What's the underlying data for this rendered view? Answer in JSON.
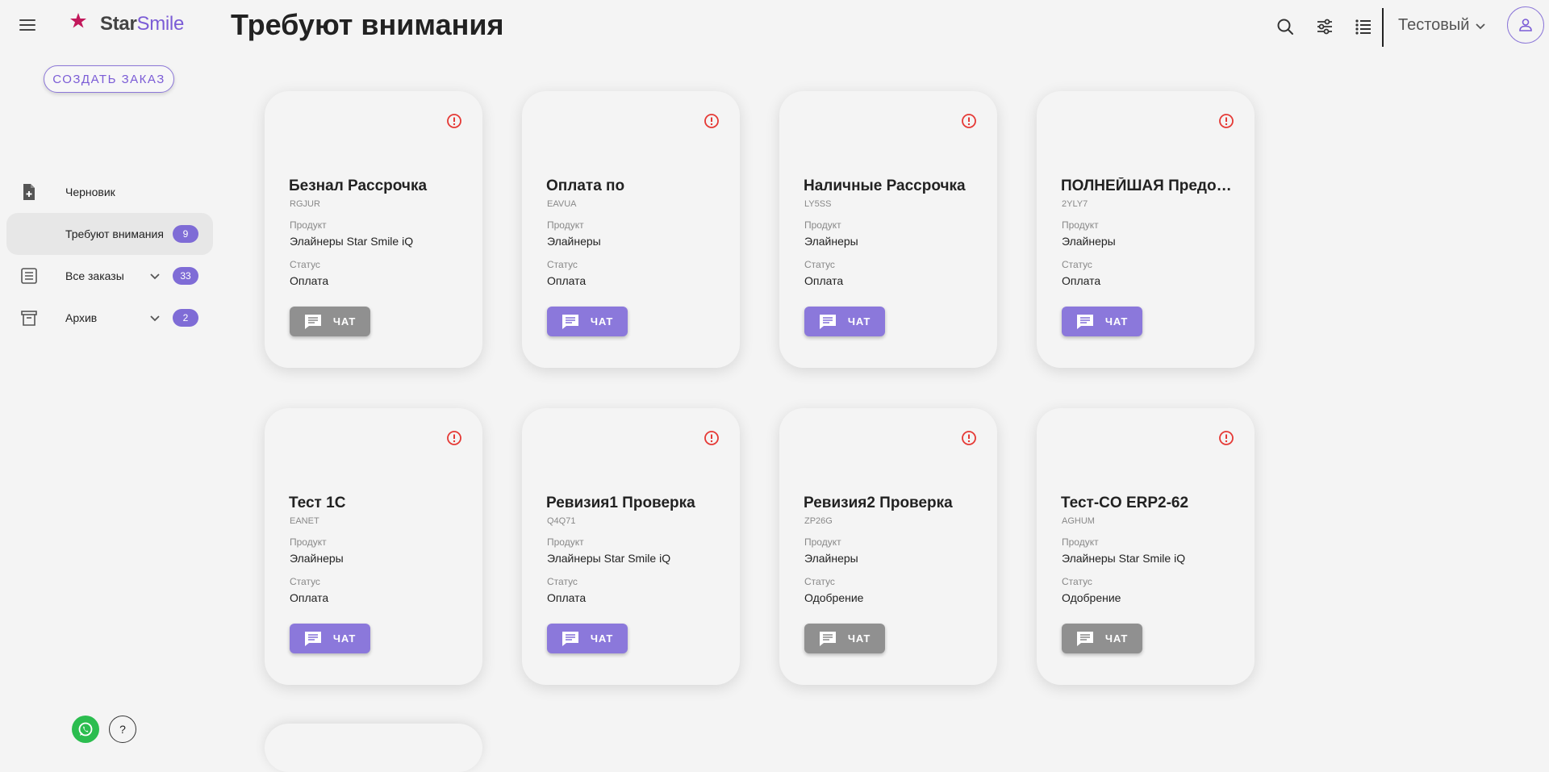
{
  "brand": {
    "logo_part1": "Star",
    "logo_part2": "Smile",
    "accent": "#7f6cd6"
  },
  "header": {
    "title": "Требуют внимания",
    "user_name": "Тестовый"
  },
  "sidebar": {
    "create_label": "СОЗДАТЬ ЗАКАЗ",
    "items": [
      {
        "label": "Черновик",
        "icon": "file-plus-icon"
      },
      {
        "label": "Требуют внимания",
        "badge": "9"
      },
      {
        "label": "Все заказы",
        "badge": "33",
        "icon": "list-icon"
      },
      {
        "label": "Архив",
        "badge": "2",
        "icon": "archive-icon"
      }
    ],
    "help_label": "?"
  },
  "cards": {
    "product_label": "Продукт",
    "status_label": "Статус",
    "chat_label": "ЧАТ",
    "items": [
      {
        "title": "Безнал Рассрочка",
        "code": "RGJUR",
        "product": "Элайнеры Star Smile iQ",
        "status": "Оплата",
        "chat_active": false
      },
      {
        "title": "Оплата по",
        "code": "EAVUA",
        "product": "Элайнеры",
        "status": "Оплата",
        "chat_active": true
      },
      {
        "title": "Наличные Рассрочка",
        "code": "LY5SS",
        "product": "Элайнеры",
        "status": "Оплата",
        "chat_active": true
      },
      {
        "title": "ПОЛНЕЙШАЯ Предоплата",
        "code": "2YLY7",
        "product": "Элайнеры",
        "status": "Оплата",
        "chat_active": true
      },
      {
        "title": "Тест 1С",
        "code": "EANET",
        "product": "Элайнеры",
        "status": "Оплата",
        "chat_active": true
      },
      {
        "title": "Ревизия1 Проверка",
        "code": "Q4Q71",
        "product": "Элайнеры Star Smile iQ",
        "status": "Оплата",
        "chat_active": true
      },
      {
        "title": "Ревизия2 Проверка",
        "code": "ZP26G",
        "product": "Элайнеры",
        "status": "Одобрение",
        "chat_active": false
      },
      {
        "title": "Тест-CO ERP2-62",
        "code": "AGHUM",
        "product": "Элайнеры Star Smile iQ",
        "status": "Одобрение",
        "chat_active": false
      }
    ]
  }
}
